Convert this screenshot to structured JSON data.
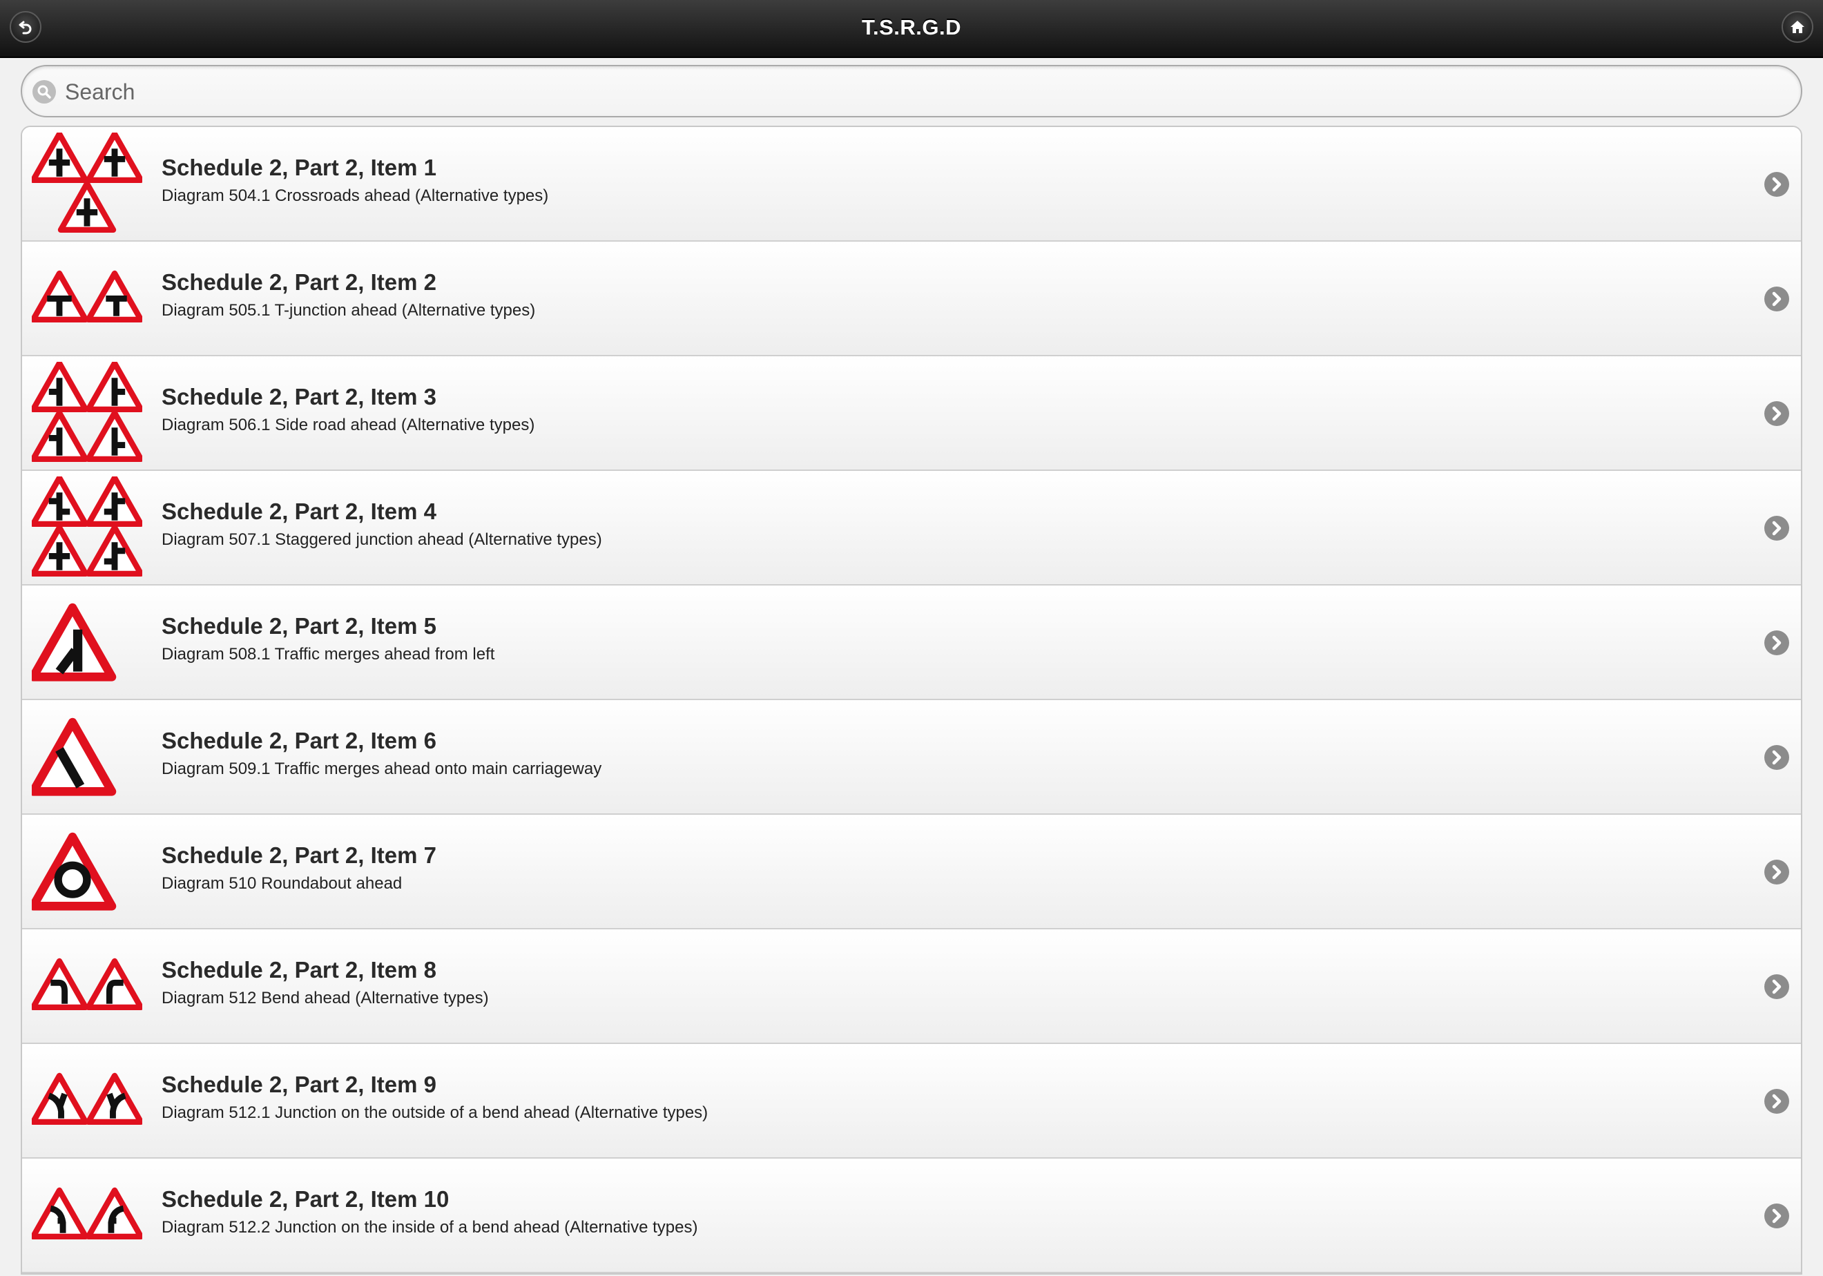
{
  "header": {
    "title": "T.S.R.G.D",
    "back_icon": "back-arrow-icon",
    "home_icon": "home-icon"
  },
  "search": {
    "placeholder": "Search",
    "value": "",
    "icon": "search-icon"
  },
  "colors": {
    "sign_red": "#e0101e",
    "header_dark": "#1a1a1a",
    "chevron_gray": "#8c8c8c"
  },
  "items": [
    {
      "title": "Schedule 2, Part 2, Item 1",
      "subtitle": "Diagram 504.1 Crossroads ahead (Alternative types)",
      "sign": "crossroads-ahead-signs"
    },
    {
      "title": "Schedule 2, Part 2, Item 2",
      "subtitle": "Diagram 505.1 T-junction ahead (Alternative types)",
      "sign": "t-junction-ahead-signs"
    },
    {
      "title": "Schedule 2, Part 2, Item 3",
      "subtitle": "Diagram 506.1 Side road ahead (Alternative types)",
      "sign": "side-road-ahead-signs"
    },
    {
      "title": "Schedule 2, Part 2, Item 4",
      "subtitle": "Diagram 507.1 Staggered junction ahead (Alternative types)",
      "sign": "staggered-junction-ahead-signs"
    },
    {
      "title": "Schedule 2, Part 2, Item 5",
      "subtitle": "Diagram 508.1 Traffic merges ahead from left",
      "sign": "traffic-merges-from-left-sign"
    },
    {
      "title": "Schedule 2, Part 2, Item 6",
      "subtitle": "Diagram 509.1 Traffic merges ahead onto main carriageway",
      "sign": "traffic-merges-onto-carriageway-sign"
    },
    {
      "title": "Schedule 2, Part 2, Item 7",
      "subtitle": "Diagram 510 Roundabout ahead",
      "sign": "roundabout-ahead-sign"
    },
    {
      "title": "Schedule 2, Part 2, Item 8",
      "subtitle": "Diagram 512 Bend ahead (Alternative types)",
      "sign": "bend-ahead-signs"
    },
    {
      "title": "Schedule 2, Part 2, Item 9",
      "subtitle": "Diagram 512.1 Junction on the outside of a bend ahead (Alternative types)",
      "sign": "junction-outside-bend-signs"
    },
    {
      "title": "Schedule 2, Part 2, Item 10",
      "subtitle": "Diagram 512.2 Junction on the inside of a bend ahead (Alternative types)",
      "sign": "junction-inside-bend-signs"
    }
  ]
}
